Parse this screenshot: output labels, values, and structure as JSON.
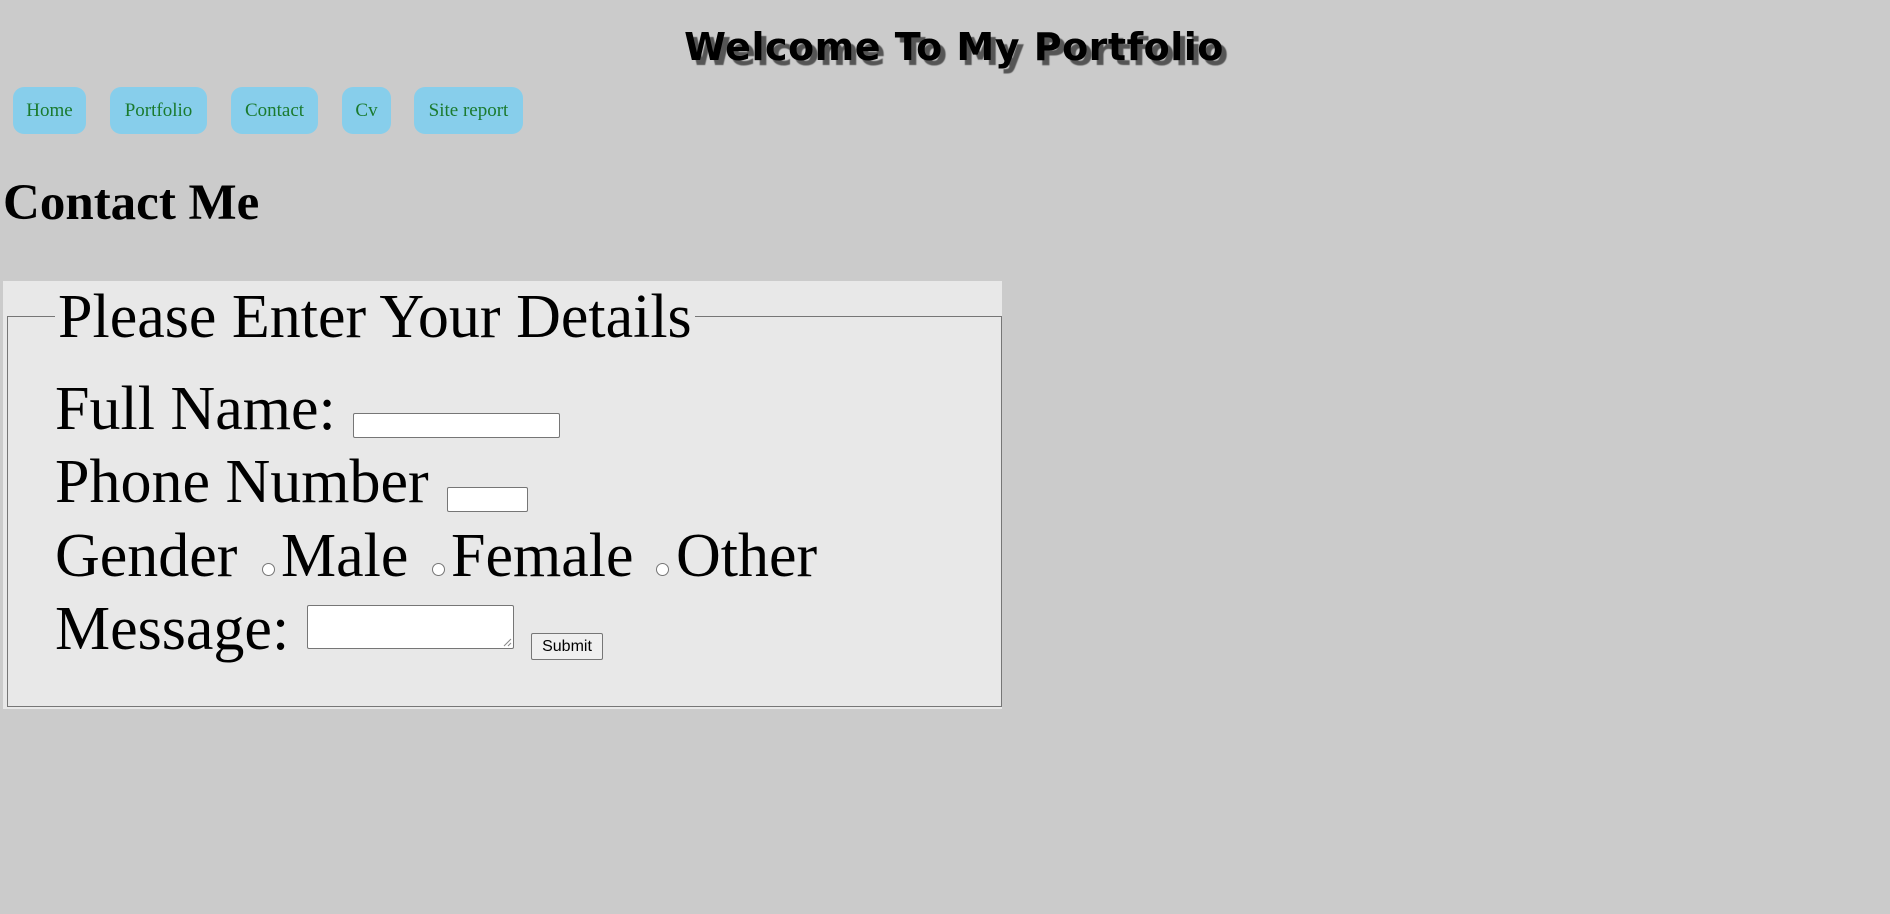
{
  "header": {
    "title": "Welcome To My Portfolio"
  },
  "nav": {
    "items": [
      {
        "label": "Home"
      },
      {
        "label": "Portfolio"
      },
      {
        "label": "Contact"
      },
      {
        "label": "Cv"
      },
      {
        "label": "Site report"
      }
    ]
  },
  "page": {
    "heading": "Contact Me"
  },
  "form": {
    "legend": "Please Enter Your Details",
    "full_name": {
      "label": "Full Name:",
      "value": ""
    },
    "phone": {
      "label": "Phone Number",
      "value": ""
    },
    "gender": {
      "label": "Gender",
      "options": [
        {
          "label": "Male",
          "checked": false
        },
        {
          "label": "Female",
          "checked": false
        },
        {
          "label": "Other",
          "checked": false
        }
      ]
    },
    "message": {
      "label": "Message:",
      "value": ""
    },
    "submit_label": "Submit"
  },
  "colors": {
    "page_background": "#cbcbcb",
    "nav_background": "#87ceeb",
    "nav_text": "#1a7a2e",
    "form_background": "#e8e8e8"
  }
}
